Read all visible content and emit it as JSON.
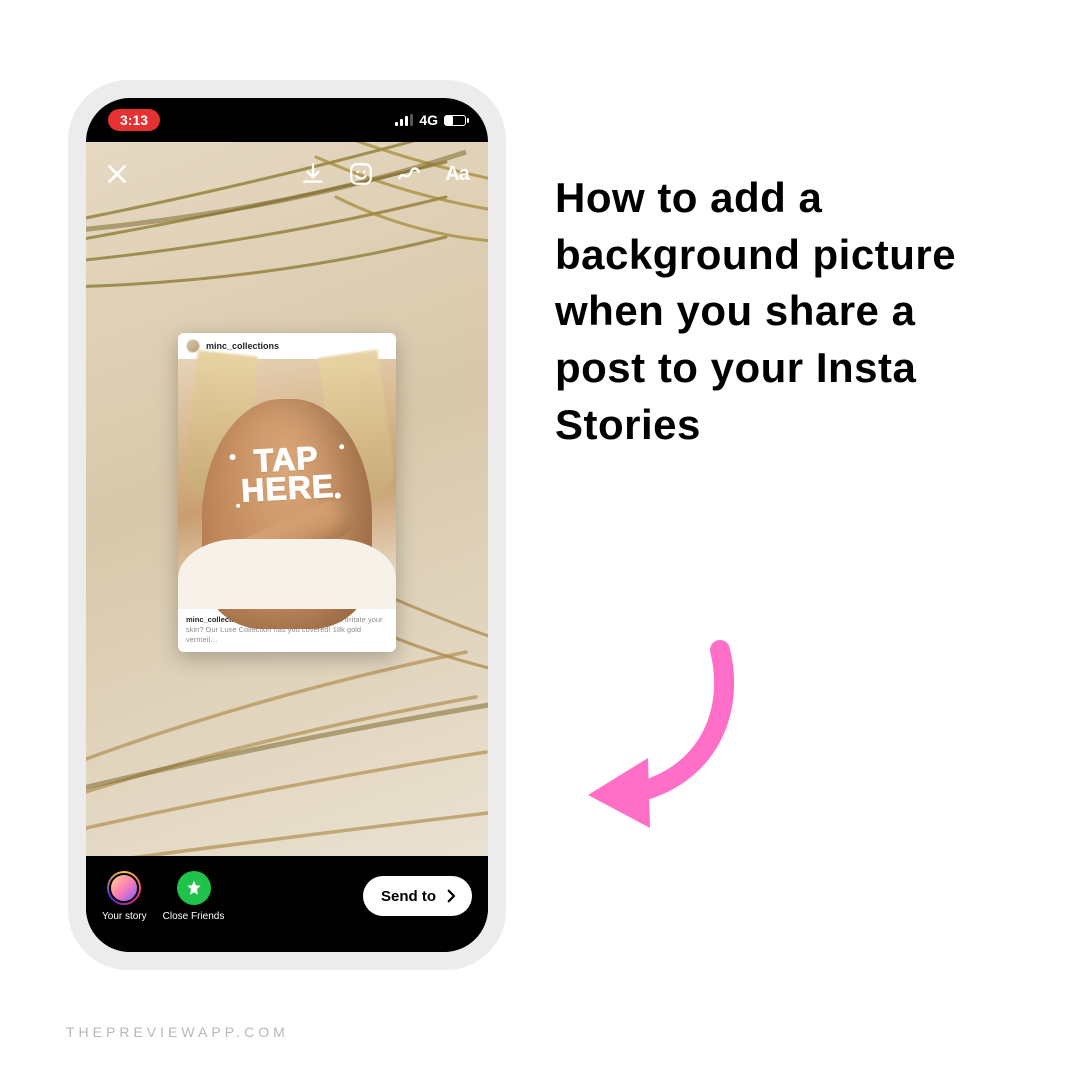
{
  "headline": "How to add a background picture when you share a post to your Insta Stories",
  "watermark": "THEPREVIEWAPP.COM",
  "colors": {
    "arrow": "#ff6ec7",
    "time_pill": "#e53131",
    "close_friends": "#1fc24b"
  },
  "statusbar": {
    "time": "3:13",
    "network_label": "4G"
  },
  "toolbar": {
    "text_tool_label": "Aa"
  },
  "post": {
    "username": "minc_collections",
    "overlay_line1": "TAP",
    "overlay_line2": "HERE",
    "caption_username": "minc_collections",
    "caption_text": "Looking for jewels that won't irritate your skin? Our Luxe Collection has you covered! 18k gold vermeil…"
  },
  "bottom": {
    "your_story_label": "Your story",
    "close_friends_label": "Close Friends",
    "send_to_label": "Send to"
  }
}
